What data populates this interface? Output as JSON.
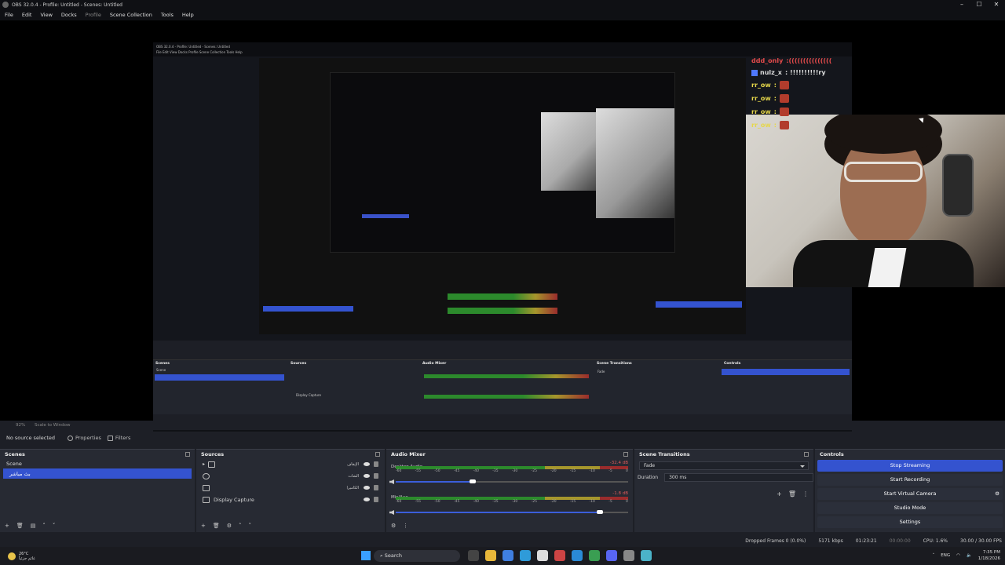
{
  "window": {
    "title": "OBS 32.0.4 - Profile: Untitled - Scenes: Untitled",
    "controls": [
      "–",
      "☐",
      "✕"
    ]
  },
  "menu": [
    "File",
    "Edit",
    "View",
    "Docks",
    "Profile",
    "Scene Collection",
    "Tools",
    "Help"
  ],
  "chat": [
    {
      "user": "ddd_only",
      "msg": ":(((((((((((((((",
      "color": "#e14a4a",
      "badge": false
    },
    {
      "user": "nulz_x",
      "msg": ": !!!!!!!!!!ry",
      "color": "#dcdcdc",
      "badge": true
    },
    {
      "user": "rr_ow",
      "msg": ":",
      "color": "#e6d74a",
      "badge": false
    },
    {
      "user": "rr_ow",
      "msg": ":",
      "color": "#e6d74a",
      "badge": false
    },
    {
      "user": "rr_ow",
      "msg": ":",
      "color": "#e6d74a",
      "badge": false
    },
    {
      "user": "rr_ow",
      "msg": ":",
      "color": "#e6d74a",
      "badge": false
    }
  ],
  "scale": {
    "zoom": "92%",
    "mode": "Scale to Window"
  },
  "toolbar": {
    "no_source": "No source selected",
    "properties": "Properties",
    "filters": "Filters"
  },
  "scenes": {
    "title": "Scenes",
    "items": [
      "Scene",
      "بث مباشر"
    ]
  },
  "sources": {
    "title": "Sources",
    "items": [
      {
        "name": "",
        "right_label": "الإيقاف",
        "icon": "folder-icon"
      },
      {
        "name": "",
        "right_label": "الشات",
        "icon": "chat-icon"
      },
      {
        "name": "",
        "right_label": "الكاميرا",
        "icon": "camera-icon"
      },
      {
        "name": "Display Capture",
        "right_label": "",
        "icon": "monitor-icon"
      }
    ]
  },
  "mixer": {
    "title": "Audio Mixer",
    "channels": [
      {
        "name": "Desktop Audio",
        "db": "-32.4 dB",
        "fader_pct": 0.33
      },
      {
        "name": "Mic/Aux",
        "db": "-1.8 dB",
        "fader_pct": 0.88
      }
    ],
    "ticks": [
      "-60",
      "-55",
      "-50",
      "-45",
      "-40",
      "-35",
      "-30",
      "-25",
      "-20",
      "-15",
      "-10",
      "-5",
      "0"
    ]
  },
  "transitions": {
    "title": "Scene Transitions",
    "selected": "Fade",
    "duration_label": "Duration",
    "duration_value": "300 ms"
  },
  "controls": {
    "title": "Controls",
    "buttons": [
      "Stop Streaming",
      "Start Recording",
      "Start Virtual Camera",
      "Studio Mode",
      "Settings"
    ]
  },
  "status": {
    "dropped": "Dropped Frames 0 (0.0%)",
    "kbps": "5171 kbps",
    "live": "01:23:21",
    "rec": "00:00:00",
    "cpu": "CPU: 1.6%",
    "fps": "30.00 / 30.00 FPS"
  },
  "taskbar": {
    "temp": "26°C",
    "weather": "غائم جزئياً",
    "search": "Search",
    "lang": "ENG",
    "time": "7:35 PM",
    "date": "1/18/2026"
  },
  "nested": {
    "title": "OBS 32.0.4 - Profile: Untitled - Scenes: Untitled",
    "menu": "File  Edit  View  Docks  Profile  Scene Collection  Tools  Help"
  },
  "colors": {
    "accent": "#3453cf",
    "panel": "#272a33",
    "bg": "#1d1f26"
  }
}
